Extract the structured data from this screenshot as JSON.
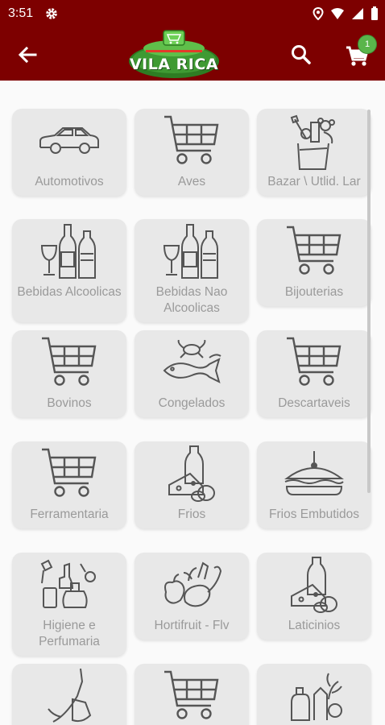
{
  "status_bar": {
    "time": "3:51"
  },
  "app_bar": {
    "logo_text": "VILA RICA",
    "cart_badge": "1"
  },
  "categories": [
    {
      "label": "Automotivos",
      "icon": "car-icon"
    },
    {
      "label": "Aves",
      "icon": "cart-icon"
    },
    {
      "label": "Bazar \\ Utlid. Lar",
      "icon": "bazaar-icon"
    },
    {
      "label": "Bebidas Alcoolicas",
      "icon": "bottles-icon"
    },
    {
      "label": "Bebidas Nao Alcoolicas",
      "icon": "bottles-icon"
    },
    {
      "label": "Bijouterias",
      "icon": "cart-icon"
    },
    {
      "label": "Bovinos",
      "icon": "cart-icon"
    },
    {
      "label": "Congelados",
      "icon": "seafood-icon"
    },
    {
      "label": "Descartaveis",
      "icon": "cart-icon"
    },
    {
      "label": "Ferramentaria",
      "icon": "cart-icon"
    },
    {
      "label": "Frios",
      "icon": "dairy-icon"
    },
    {
      "label": "Frios Embutidos",
      "icon": "sandwich-icon"
    },
    {
      "label": "Higiene e Perfumaria",
      "icon": "toiletries-icon"
    },
    {
      "label": "Hortifruit - Flv",
      "icon": "vegetables-icon"
    },
    {
      "label": "Laticinios",
      "icon": "dairy-icon"
    },
    {
      "label": "",
      "icon": "cleaning-icon"
    },
    {
      "label": "",
      "icon": "cart-icon"
    },
    {
      "label": "",
      "icon": "grocery-icon"
    }
  ]
}
